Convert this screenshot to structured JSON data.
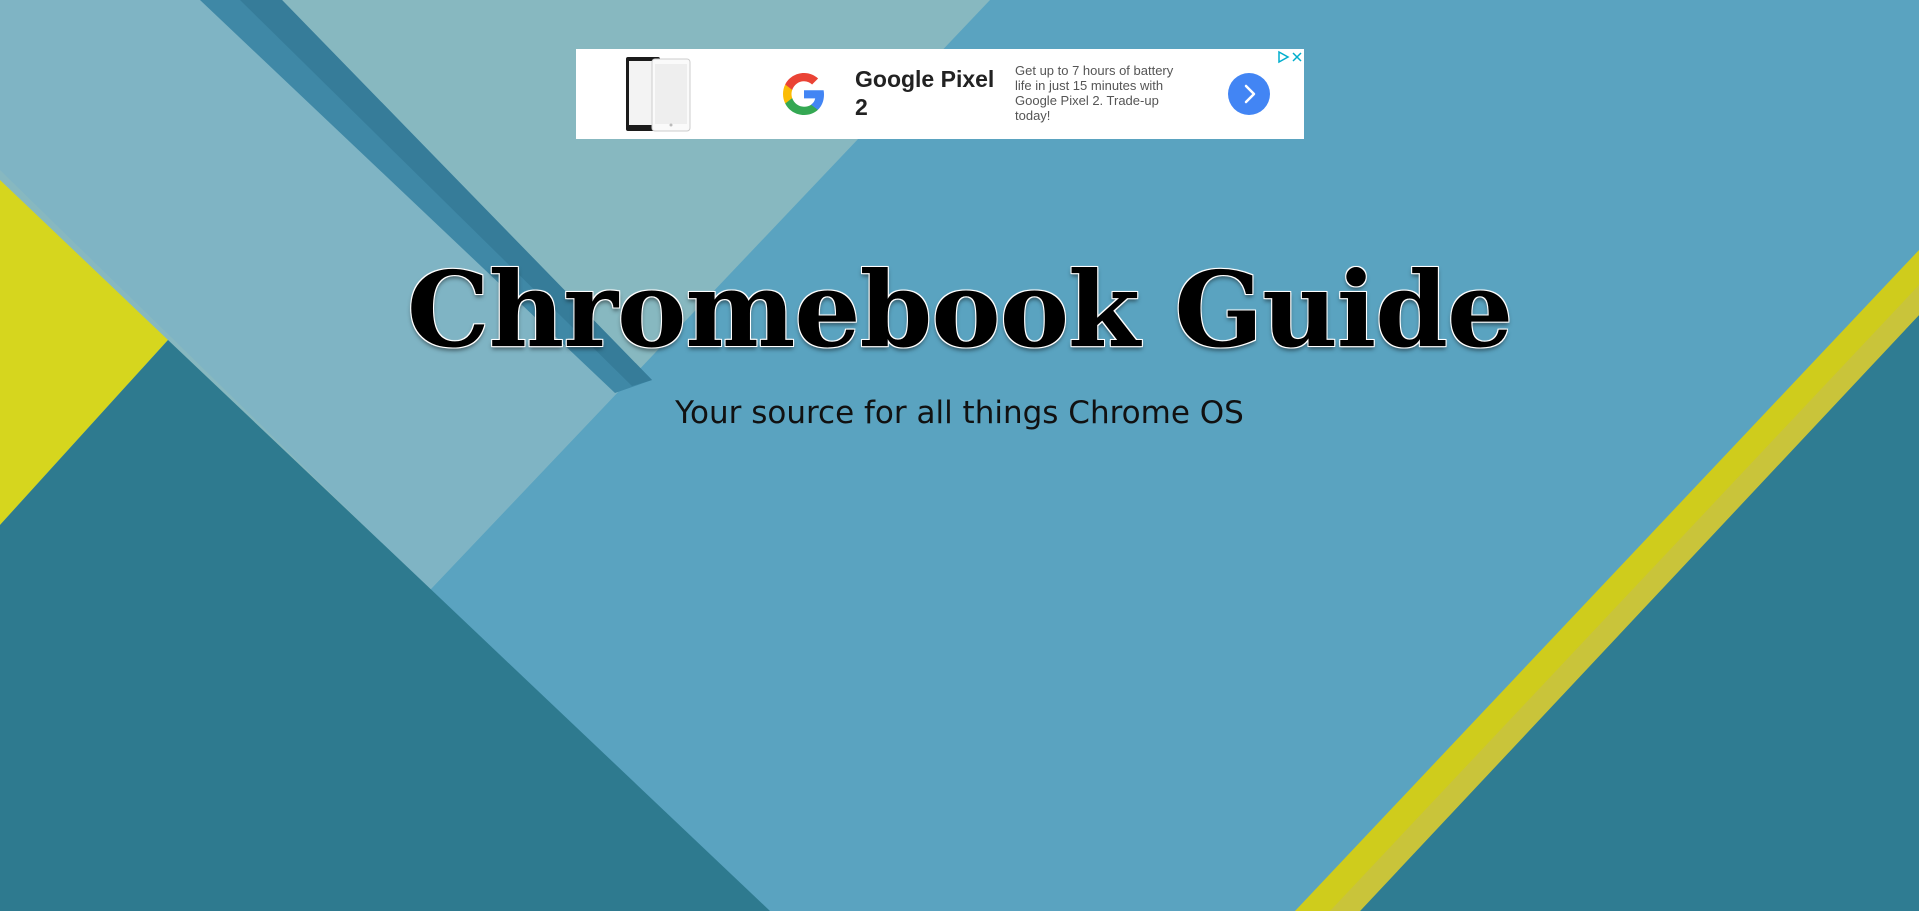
{
  "site": {
    "title": "Chromebook Guide",
    "tagline": "Your source for all things Chrome OS"
  },
  "ad": {
    "headline": "Google Pixel 2",
    "body": "Get up to 7 hours of battery life in just 15 minutes with Google Pixel 2. Trade-up today!",
    "cta_icon": "chevron-right-icon",
    "choices_icon": "ad-choices-icon",
    "close_icon": "close-icon",
    "logo_icon": "google-g-icon",
    "image": "pixel-phones-image"
  },
  "colors": {
    "bg_light_teal": "#87b8c0",
    "bg_main_blue": "#5aa3c0",
    "bg_dark_teal": "#2e7a8f",
    "bg_stripe_blue": "#3f88a6",
    "accent_yellow": "#d4d21a",
    "cta_blue": "#4285f4"
  }
}
